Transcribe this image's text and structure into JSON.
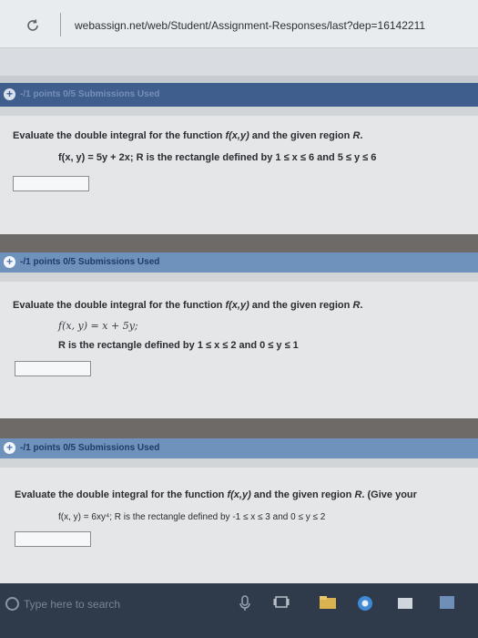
{
  "browser": {
    "url": "webassign.net/web/Student/Assignment-Responses/last?dep=16142211",
    "reload_icon": "reload-icon"
  },
  "questions": [
    {
      "header": "-/1 points  0/5 Submissions Used",
      "prompt_prefix": "Evaluate the double integral for the function ",
      "prompt_fn": "f(x,y)",
      "prompt_suffix": " and the given region ",
      "prompt_region": "R",
      "prompt_end": ".",
      "formula_line1": "f(x, y) = 5y + 2x; R is the rectangle defined by 1 ≤ x ≤ 6 and 5 ≤ y ≤ 6",
      "answer": ""
    },
    {
      "header": "-/1 points  0/5 Submissions Used",
      "prompt_prefix": "Evaluate the double integral for the function ",
      "prompt_fn": "f(x,y)",
      "prompt_suffix": " and the given region ",
      "prompt_region": "R",
      "prompt_end": ".",
      "formula_line1": "f(x, y) = x + 5y;",
      "formula_line2": "R is the rectangle defined by 1 ≤ x ≤ 2 and 0 ≤ y ≤ 1",
      "answer": ""
    },
    {
      "header": "-/1 points  0/5 Submissions Used",
      "prompt_prefix": "Evaluate the double integral for the function ",
      "prompt_fn": "f(x,y)",
      "prompt_suffix": " and the given region ",
      "prompt_region": "R",
      "prompt_end": ". (Give your",
      "formula_line1": "f(x, y) = 6xy⁴; R is the rectangle defined by -1 ≤ x ≤ 3 and 0 ≤ y ≤ 2",
      "answer": ""
    }
  ],
  "taskbar": {
    "search_placeholder": "Type here to search"
  },
  "colors": {
    "header_bar": "#6f92bd",
    "header_text": "#1f3b67",
    "panel": "#e4e6e8",
    "taskbar": "#2f3a4b"
  }
}
